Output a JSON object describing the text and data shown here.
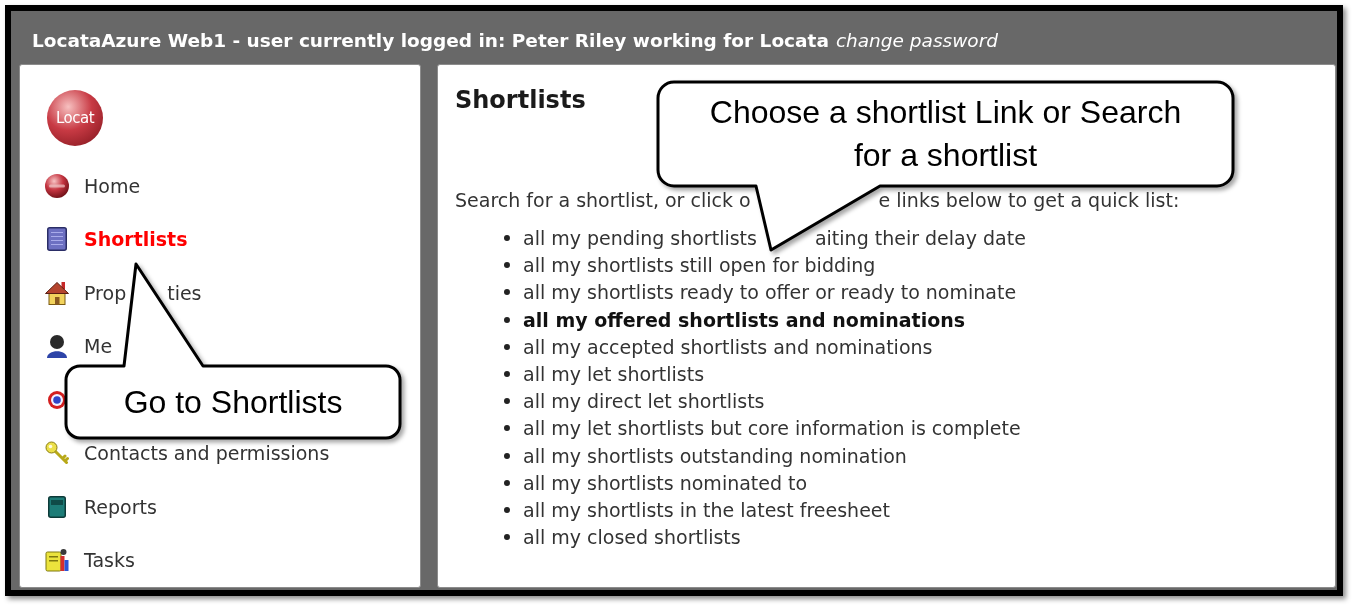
{
  "window": {
    "title": "LocataAzure Web1 - user currently logged in: Peter Riley working for Locata",
    "title_link": "change password"
  },
  "sidebar": {
    "logo_text": "Locat",
    "items": [
      {
        "parts": [
          "Home"
        ],
        "selected": false
      },
      {
        "parts": [
          "Shortlists"
        ],
        "selected": true
      },
      {
        "parts": [
          "Prop",
          "ties"
        ],
        "selected": false
      },
      {
        "parts": [
          "Me"
        ],
        "selected": false
      },
      {
        "selected": false
      },
      {
        "parts": [
          "Contacts and permissions"
        ],
        "selected": false
      },
      {
        "parts": [
          "Reports"
        ],
        "selected": false
      },
      {
        "parts": [
          "Tasks"
        ],
        "selected": false
      }
    ]
  },
  "content": {
    "heading": "Shortlists",
    "intro_parts": [
      "Search for a shortlist, or click o",
      "e links below to get a quick list:"
    ],
    "links": [
      {
        "parts": [
          "all my pending shortlists",
          "aiting their delay date"
        ],
        "highlighted": false
      },
      {
        "parts": [
          "all my shortlists still open for bidding"
        ],
        "highlighted": false
      },
      {
        "parts": [
          "all my shortlists ready to offer or ready to nominate"
        ],
        "highlighted": false
      },
      {
        "parts": [
          "all my offered shortlists and nominations"
        ],
        "highlighted": true
      },
      {
        "parts": [
          "all my accepted shortlists and nominations"
        ],
        "highlighted": false
      },
      {
        "parts": [
          "all my let shortlists"
        ],
        "highlighted": false
      },
      {
        "parts": [
          "all my direct let shortlists"
        ],
        "highlighted": false
      },
      {
        "parts": [
          "all my let shortlists but core information is complete"
        ],
        "highlighted": false
      },
      {
        "parts": [
          "all my shortlists outstanding nomination"
        ],
        "highlighted": false
      },
      {
        "parts": [
          "all my shortlists nominated to"
        ],
        "highlighted": false
      },
      {
        "parts": [
          "all my shortlists in the latest freesheet"
        ],
        "highlighted": false
      },
      {
        "parts": [
          "all my closed shortlists"
        ],
        "highlighted": false
      }
    ]
  },
  "callouts": [
    {
      "text": "Choose a shortlist Link or Search for a shortlist"
    },
    {
      "text": "Go to Shortlists"
    }
  ]
}
